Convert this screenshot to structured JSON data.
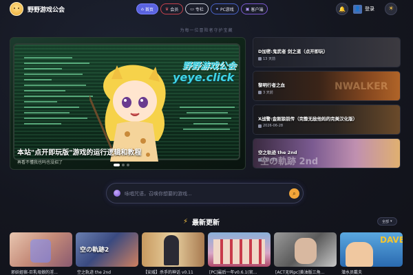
{
  "header": {
    "brand": "野野游戏公会",
    "nav": [
      {
        "label": "首页",
        "icon": "home-icon"
      },
      {
        "label": "会员",
        "icon": "crown-icon"
      },
      {
        "label": "专栏",
        "icon": "column-icon"
      },
      {
        "label": "PC游戏",
        "icon": "gamepad-icon"
      },
      {
        "label": "客户端",
        "icon": "client-icon"
      }
    ],
    "login_label": "登录"
  },
  "tagline": "为每一位冒险者守护宝藏",
  "hero": {
    "watermark_line1": "野野游戏公会",
    "watermark_line2": "yeye.click",
    "title": "本站\"点开即玩版\"游戏的运行逻辑和教程",
    "subtitle": "再看不懂我也吗也没招了"
  },
  "side_items": [
    {
      "title": "D加密:鬼武者 剑之道（点开即玩）",
      "date": "13 天前"
    },
    {
      "title": "黎明行者之血",
      "date": "3 天前"
    },
    {
      "title": "X战警:金刚狼前传（完整无敌他妈的完美汉化版）",
      "date": "2026-06-28"
    },
    {
      "title": "空之轨迹 the 2nd",
      "date": "19小时前"
    }
  ],
  "search": {
    "placeholder": "咏唱咒语，召唤你想要的游戏..."
  },
  "latest": {
    "title": "最新更新",
    "all_label": "全部",
    "cards": [
      {
        "title": "邪妖姐宿-巨乳母娘的淫..."
      },
      {
        "title": "空之轨迹 the 2nd"
      },
      {
        "title": "【安威】杀手的神话 v0.11"
      },
      {
        "title": "[PC]最后一年v0.6.1(官..."
      },
      {
        "title": "[ACT无码pc]黄油版三角..."
      },
      {
        "title": "潜水员戴夫"
      }
    ]
  },
  "colors": {
    "accent": "#5a63e0",
    "search_go": "#f1a53a",
    "bolt": "#f7c344"
  }
}
